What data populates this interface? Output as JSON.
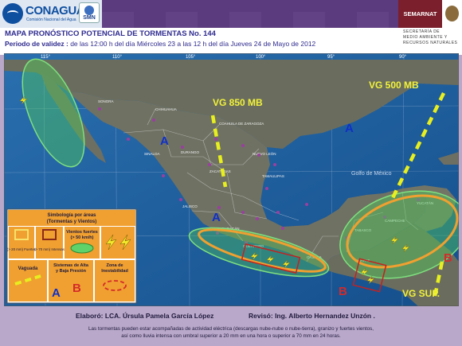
{
  "header": {
    "logo_text": "CONAGUA",
    "logo_sub": "Comisión Nacional del Agua",
    "smn_label": "SMN",
    "semarnat_label": "SEMARNAT",
    "secretaria_lines": [
      "SECRETARÍA DE",
      "MEDIO AMBIENTE Y",
      "RECURSOS NATURALES"
    ]
  },
  "title": {
    "main": "MAPA PRONÓSTICO POTENCIAL DE TORMENTAS  No. 144",
    "validity_label": "Periodo de validez :",
    "validity_text": " de las 12:00 h del día Miércoles 23 a las 12 h del día Jueves 24 de Mayo de 2012"
  },
  "map": {
    "longitudes": [
      "115°",
      "110°",
      "105°",
      "100°",
      "95°",
      "90°"
    ],
    "labels": {
      "vg850": "VG 850 MB",
      "vg500": "VG 500 MB",
      "vgsup": "VG SUP.",
      "golfo": "Golfo de México"
    },
    "pressure_marks": {
      "A_nw": "A",
      "A_gulf": "A",
      "A_center": "A",
      "B_south": "B",
      "B_east": "B"
    },
    "places": [
      "SONORA",
      "CHIHUAHUA",
      "COAHUILA DE ZARAGOZA",
      "NUEVO LEÓN",
      "DURANGO",
      "SINALOA",
      "ZACATECAS",
      "TAMAULIPAS",
      "JALISCO",
      "MICHOACÁN",
      "GUERRERO",
      "OAXACA",
      "CAMPECHE",
      "YUCATÁN",
      "TABASCO",
      "CHIAPAS"
    ]
  },
  "legend": {
    "title_line1": "Simbología por áreas",
    "title_line2": "(Tormentas y Vientos)",
    "storm_20": "(> 20 mm) Fuertes",
    "storm_70": "(> 70 mm) Intensas",
    "winds_line1": "Vientos fuertes",
    "winds_line2": "(> 50 km/h)",
    "vaguada": "Vaguada",
    "systems_line1": "Sistemas de Alta",
    "systems_line2": "y Baja Presión",
    "instab_line1": "Zona de",
    "instab_line2": "Inestabilidad",
    "A": "A",
    "B": "B"
  },
  "footer": {
    "elaboro": "Elaboró: LCA. Úrsula Pamela García López",
    "reviso": "Revisó: Ing. Alberto Hernandez Unzón .",
    "note_line1": "Las tormentas pueden estar acompañadas de actividad eléctrica (descargas nube-nube o nube-tierra), granizo y fuertes vientos,",
    "note_line2": "así como lluvia intensa con umbral superior a 20 mm en una hora o superior a 70 mm en 24 horas."
  },
  "colors": {
    "ocean": "#1f5f9e",
    "land": "#6d6f62",
    "header_purple": "#5b3b7d",
    "semarnat": "#7a1f2b",
    "footer_bg": "#b9a8c9",
    "vaguada": "#e8ef1e",
    "storm_orange": "#f0a030",
    "instability": "#d42a2a",
    "high_pressure": "#1030c8"
  }
}
